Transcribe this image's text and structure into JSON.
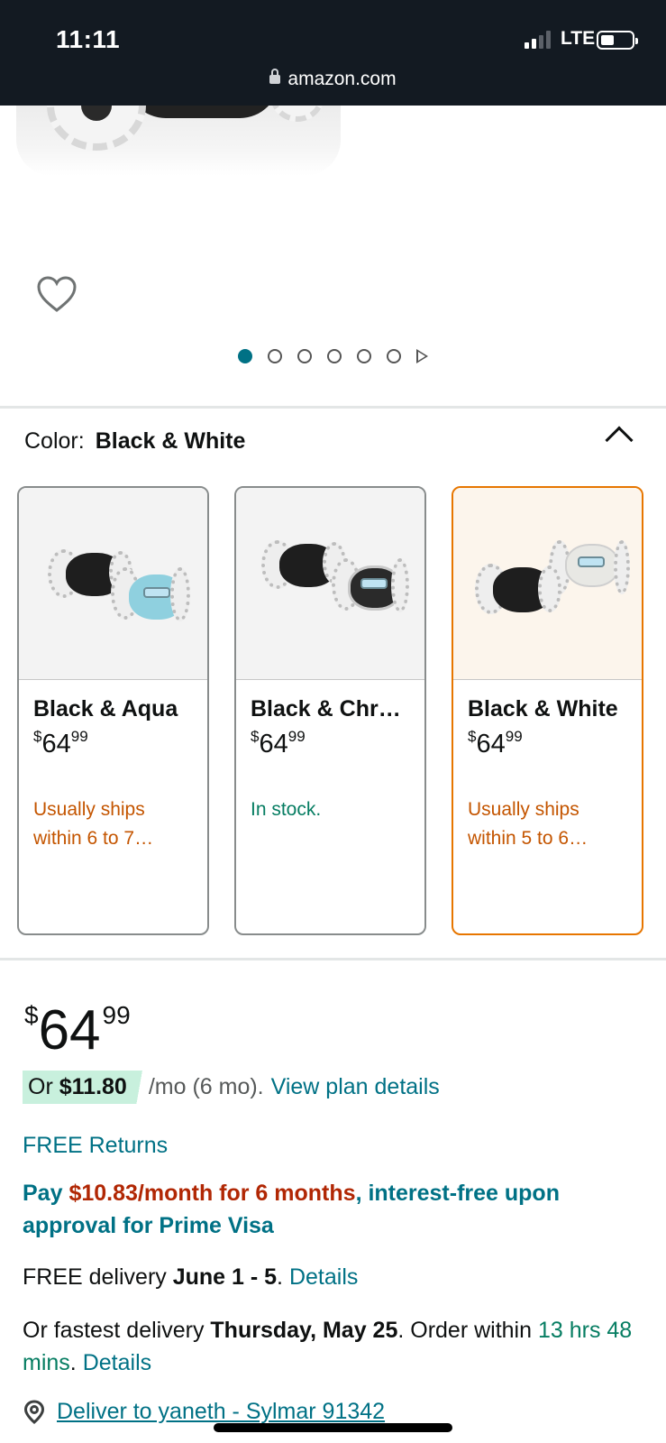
{
  "status_bar": {
    "time": "11:11",
    "network": "LTE",
    "url": "amazon.com"
  },
  "gallery": {
    "favorite_icon": "heart-outline-icon",
    "page_count": 6,
    "active_page": 1
  },
  "color_selector": {
    "label": "Color:",
    "selected": "Black & White",
    "options": [
      {
        "name": "Black & Aqua",
        "currency": "$",
        "price_whole": "64",
        "price_cents": "99",
        "availability": "Usually ships within 6 to 7…",
        "availability_color": "#c45500",
        "selected": false
      },
      {
        "name": "Black & Chr…",
        "currency": "$",
        "price_whole": "64",
        "price_cents": "99",
        "availability": "In stock.",
        "availability_color": "#067d62",
        "selected": false
      },
      {
        "name": "Black & White",
        "currency": "$",
        "price_whole": "64",
        "price_cents": "99",
        "availability": "Usually ships within 5 to 6…",
        "availability_color": "#c45500",
        "selected": true
      }
    ]
  },
  "price": {
    "currency": "$",
    "whole": "64",
    "cents": "99"
  },
  "installment": {
    "prefix": "Or",
    "amount": "$11.80",
    "term": "/mo (6 mo).",
    "link": "View plan details"
  },
  "free_returns": "FREE Returns",
  "prime_offer": {
    "part1": "Pay ",
    "highlight": "$10.83/month for 6 months",
    "part2": ", interest-free upon approval for Prime Visa"
  },
  "delivery": {
    "prefix": "FREE delivery ",
    "date": "June 1 - 5",
    "suffix": ". ",
    "link": "Details"
  },
  "fastest": {
    "prefix": "Or fastest delivery ",
    "date": "Thursday, May 25",
    "middle": ". Order within ",
    "countdown": "13 hrs 48 mins",
    "suffix": ". ",
    "link": "Details"
  },
  "deliver_to": "Deliver to yaneth - Sylmar 91342",
  "colors": {
    "link": "#007185",
    "warning": "#c45500",
    "success": "#067d62",
    "deal_red": "#b12704",
    "selected_border": "#e77600",
    "header_bg": "#131a22"
  }
}
